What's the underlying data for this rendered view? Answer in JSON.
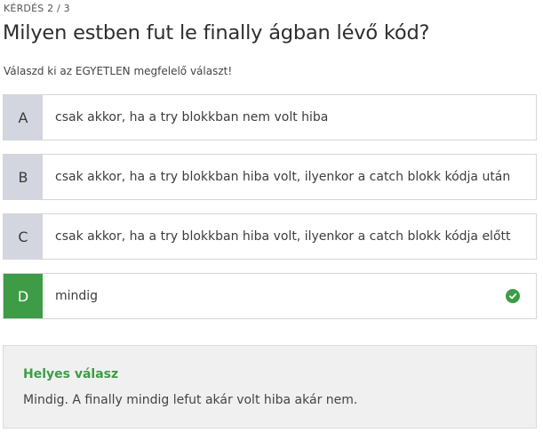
{
  "question": {
    "counter": "KÉRDÉS 2 / 3",
    "title": "Milyen estben fut le finally ágban lévő kód?",
    "instruction": "Válaszd ki az EGYETLEN megfelelő választ!"
  },
  "options": [
    {
      "letter": "A",
      "text": "csak akkor, ha a try blokkban nem volt hiba"
    },
    {
      "letter": "B",
      "text": "csak akkor, ha a try blokkban hiba volt, ilyenkor a catch blokk kódja után"
    },
    {
      "letter": "C",
      "text": "csak akkor, ha a try blokkban hiba volt, ilyenkor a catch blokk kódja előtt"
    },
    {
      "letter": "D",
      "text": "mindig",
      "correct": true,
      "icon": "check-circle-icon"
    }
  ],
  "answer": {
    "heading": "Helyes válasz",
    "explanation": "Mindig. A finally mindig lefut akár volt hiba akár nem."
  },
  "colors": {
    "correct": "#3d9c45",
    "letter_bg": "#d3d6de",
    "answer_bg": "#f0f0f0"
  }
}
